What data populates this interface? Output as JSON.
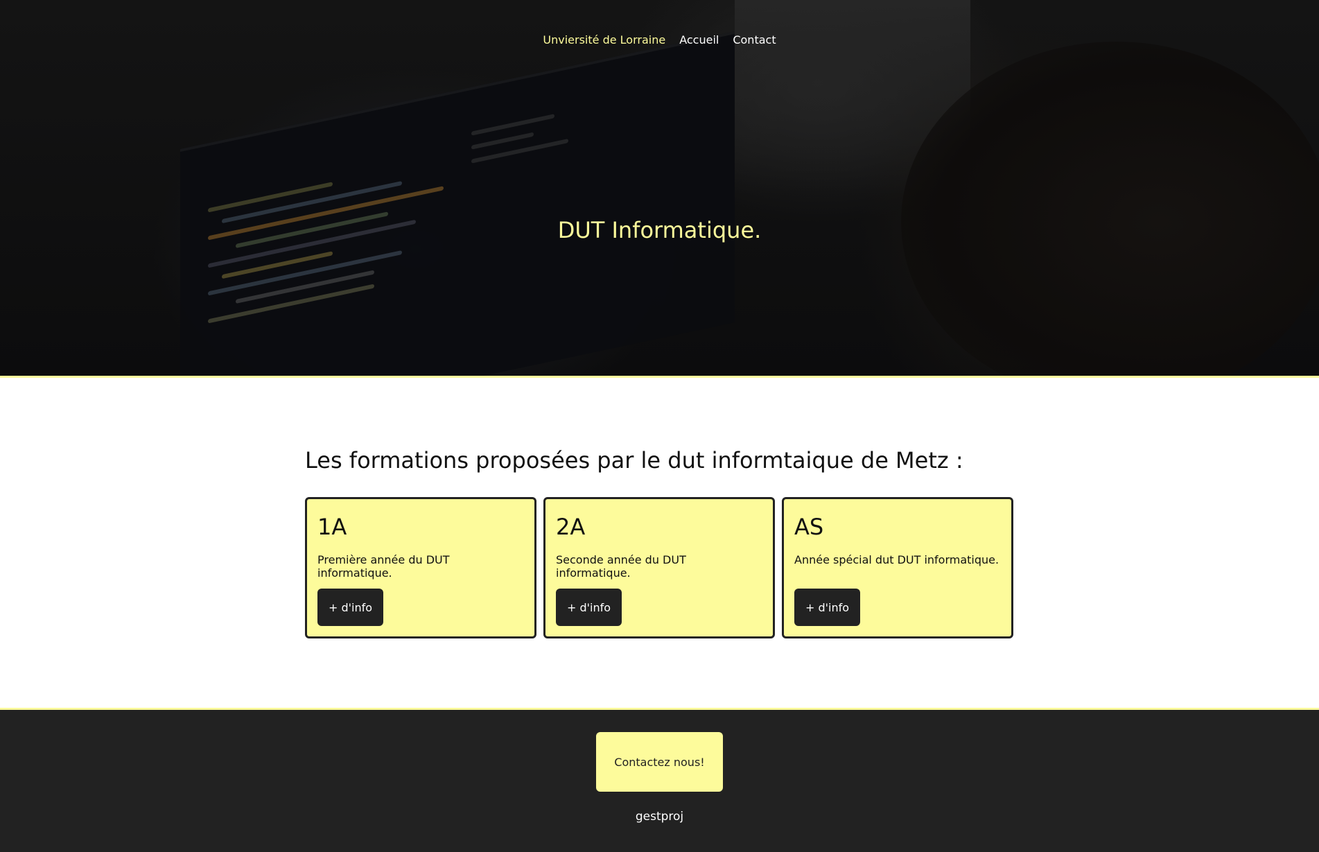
{
  "nav": {
    "brand": "Unviersité de Lorraine",
    "items": [
      {
        "label": "Accueil"
      },
      {
        "label": "Contact"
      }
    ]
  },
  "hero": {
    "title": "DUT Informatique."
  },
  "formations": {
    "heading": "Les formations proposées par le dut informtaique de Metz :",
    "cards": [
      {
        "title": "1A",
        "description": "Première année du DUT informatique.",
        "button": "+ d'info"
      },
      {
        "title": "2A",
        "description": "Seconde année du DUT informatique.",
        "button": "+ d'info"
      },
      {
        "title": "AS",
        "description": "Année spécial dut DUT informatique.",
        "button": "+ d'info"
      }
    ]
  },
  "footer": {
    "contact_button": "Contactez nous!",
    "text": "gestproj"
  },
  "colors": {
    "accent": "#fdfb9b",
    "dark": "#222222",
    "hero_bg": "#0d0d0e"
  }
}
